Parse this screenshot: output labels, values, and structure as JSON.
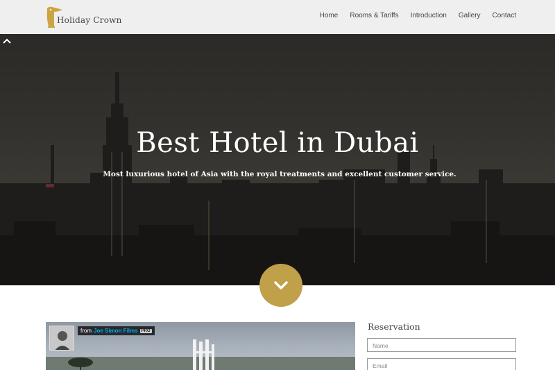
{
  "brand": {
    "name": "Holiday Crown",
    "accent": "#c0a048"
  },
  "nav": {
    "items": [
      "Home",
      "Rooms & Tariffs",
      "Introduction",
      "Gallery",
      "Contact"
    ]
  },
  "hero": {
    "title": "Best Hotel in Dubai",
    "subtitle": "Most luxurious hotel of Asia with the royal treatments and excellent customer service.",
    "scroll_down_icon": "chevron-down-icon",
    "scroll_top_icon": "chevron-up-icon"
  },
  "video": {
    "from_label": "from",
    "author": "Joe Simon Films",
    "badge": "PRO"
  },
  "reservation": {
    "title": "Reservation",
    "name_placeholder": "Name",
    "email_placeholder": "Email"
  }
}
